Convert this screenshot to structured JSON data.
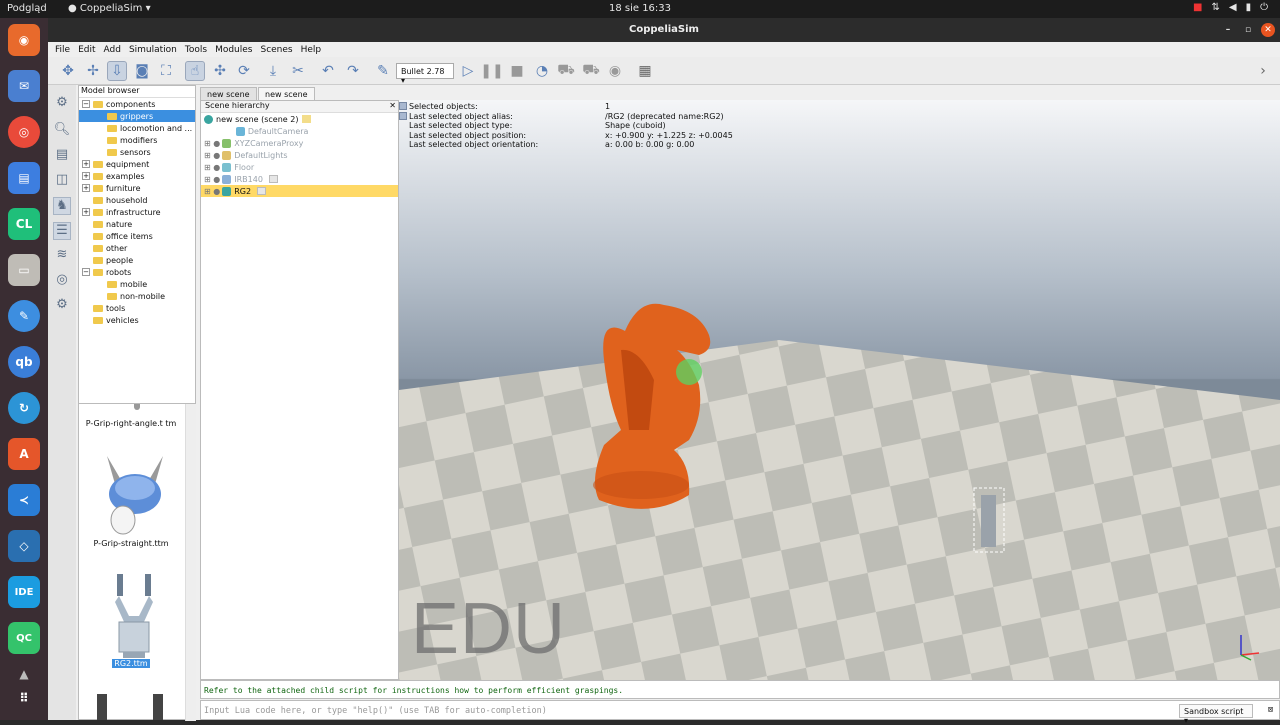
{
  "os": {
    "activities": "Podgląd",
    "app_name": "CoppeliaSim",
    "clock": "18 sie  16:33"
  },
  "window": {
    "title": "CoppeliaSim"
  },
  "menu": [
    "File",
    "Edit",
    "Add",
    "Simulation",
    "Tools",
    "Modules",
    "Scenes",
    "Help"
  ],
  "toolbar": {
    "engine": "Bullet 2.78"
  },
  "model_browser": {
    "title": "Model browser",
    "items": [
      {
        "label": "components",
        "level": 0,
        "exp": "−"
      },
      {
        "label": "grippers",
        "level": 1,
        "selected": true
      },
      {
        "label": "locomotion and ...",
        "level": 1
      },
      {
        "label": "modifiers",
        "level": 1
      },
      {
        "label": "sensors",
        "level": 1
      },
      {
        "label": "equipment",
        "level": 0,
        "exp": "+"
      },
      {
        "label": "examples",
        "level": 0,
        "exp": "+"
      },
      {
        "label": "furniture",
        "level": 0,
        "exp": "+"
      },
      {
        "label": "household",
        "level": 0
      },
      {
        "label": "infrastructure",
        "level": 0,
        "exp": "+"
      },
      {
        "label": "nature",
        "level": 0
      },
      {
        "label": "office items",
        "level": 0
      },
      {
        "label": "other",
        "level": 0
      },
      {
        "label": "people",
        "level": 0
      },
      {
        "label": "robots",
        "level": 0,
        "exp": "−"
      },
      {
        "label": "mobile",
        "level": 1
      },
      {
        "label": "non-mobile",
        "level": 1
      },
      {
        "label": "tools",
        "level": 0
      },
      {
        "label": "vehicles",
        "level": 0
      }
    ],
    "thumbs": [
      "P-Grip-right-angle.t tm",
      "P-Grip-straight.ttm",
      "RG2.ttm"
    ]
  },
  "tabs": [
    "new scene",
    "new scene"
  ],
  "hierarchy": {
    "title": "Scene hierarchy",
    "root": "new scene (scene 2)",
    "items": [
      {
        "label": "DefaultCamera",
        "dim": true
      },
      {
        "label": "XYZCameraProxy",
        "dim": true
      },
      {
        "label": "DefaultLights",
        "dim": true
      },
      {
        "label": "Floor",
        "dim": true
      },
      {
        "label": "IRB140",
        "dim": true
      },
      {
        "label": "RG2",
        "dim": false,
        "highlight": true
      }
    ]
  },
  "selection_info": [
    {
      "k": "Selected objects:",
      "v": "1"
    },
    {
      "k": "Last selected object alias:",
      "v": "/RG2    (deprecated name:RG2)"
    },
    {
      "k": "Last selected object type:",
      "v": "Shape (cuboid)"
    },
    {
      "k": "Last selected object position:",
      "v": "x: +0.900   y: +1.225   z: +0.0045"
    },
    {
      "k": "Last selected object orientation:",
      "v": "a: 0.00   b: 0.00   g: 0.00"
    }
  ],
  "watermark": "EDU",
  "console": {
    "message": "Refer to the attached child script for instructions how to perform efficient graspings.",
    "placeholder": "Input Lua code here, or type \"help()\" (use TAB for auto-completion)",
    "script_select": "Sandbox script"
  },
  "colors": {
    "selection": "#3b8fe0",
    "highlight": "#ffd966",
    "robot": "#e0621d"
  }
}
